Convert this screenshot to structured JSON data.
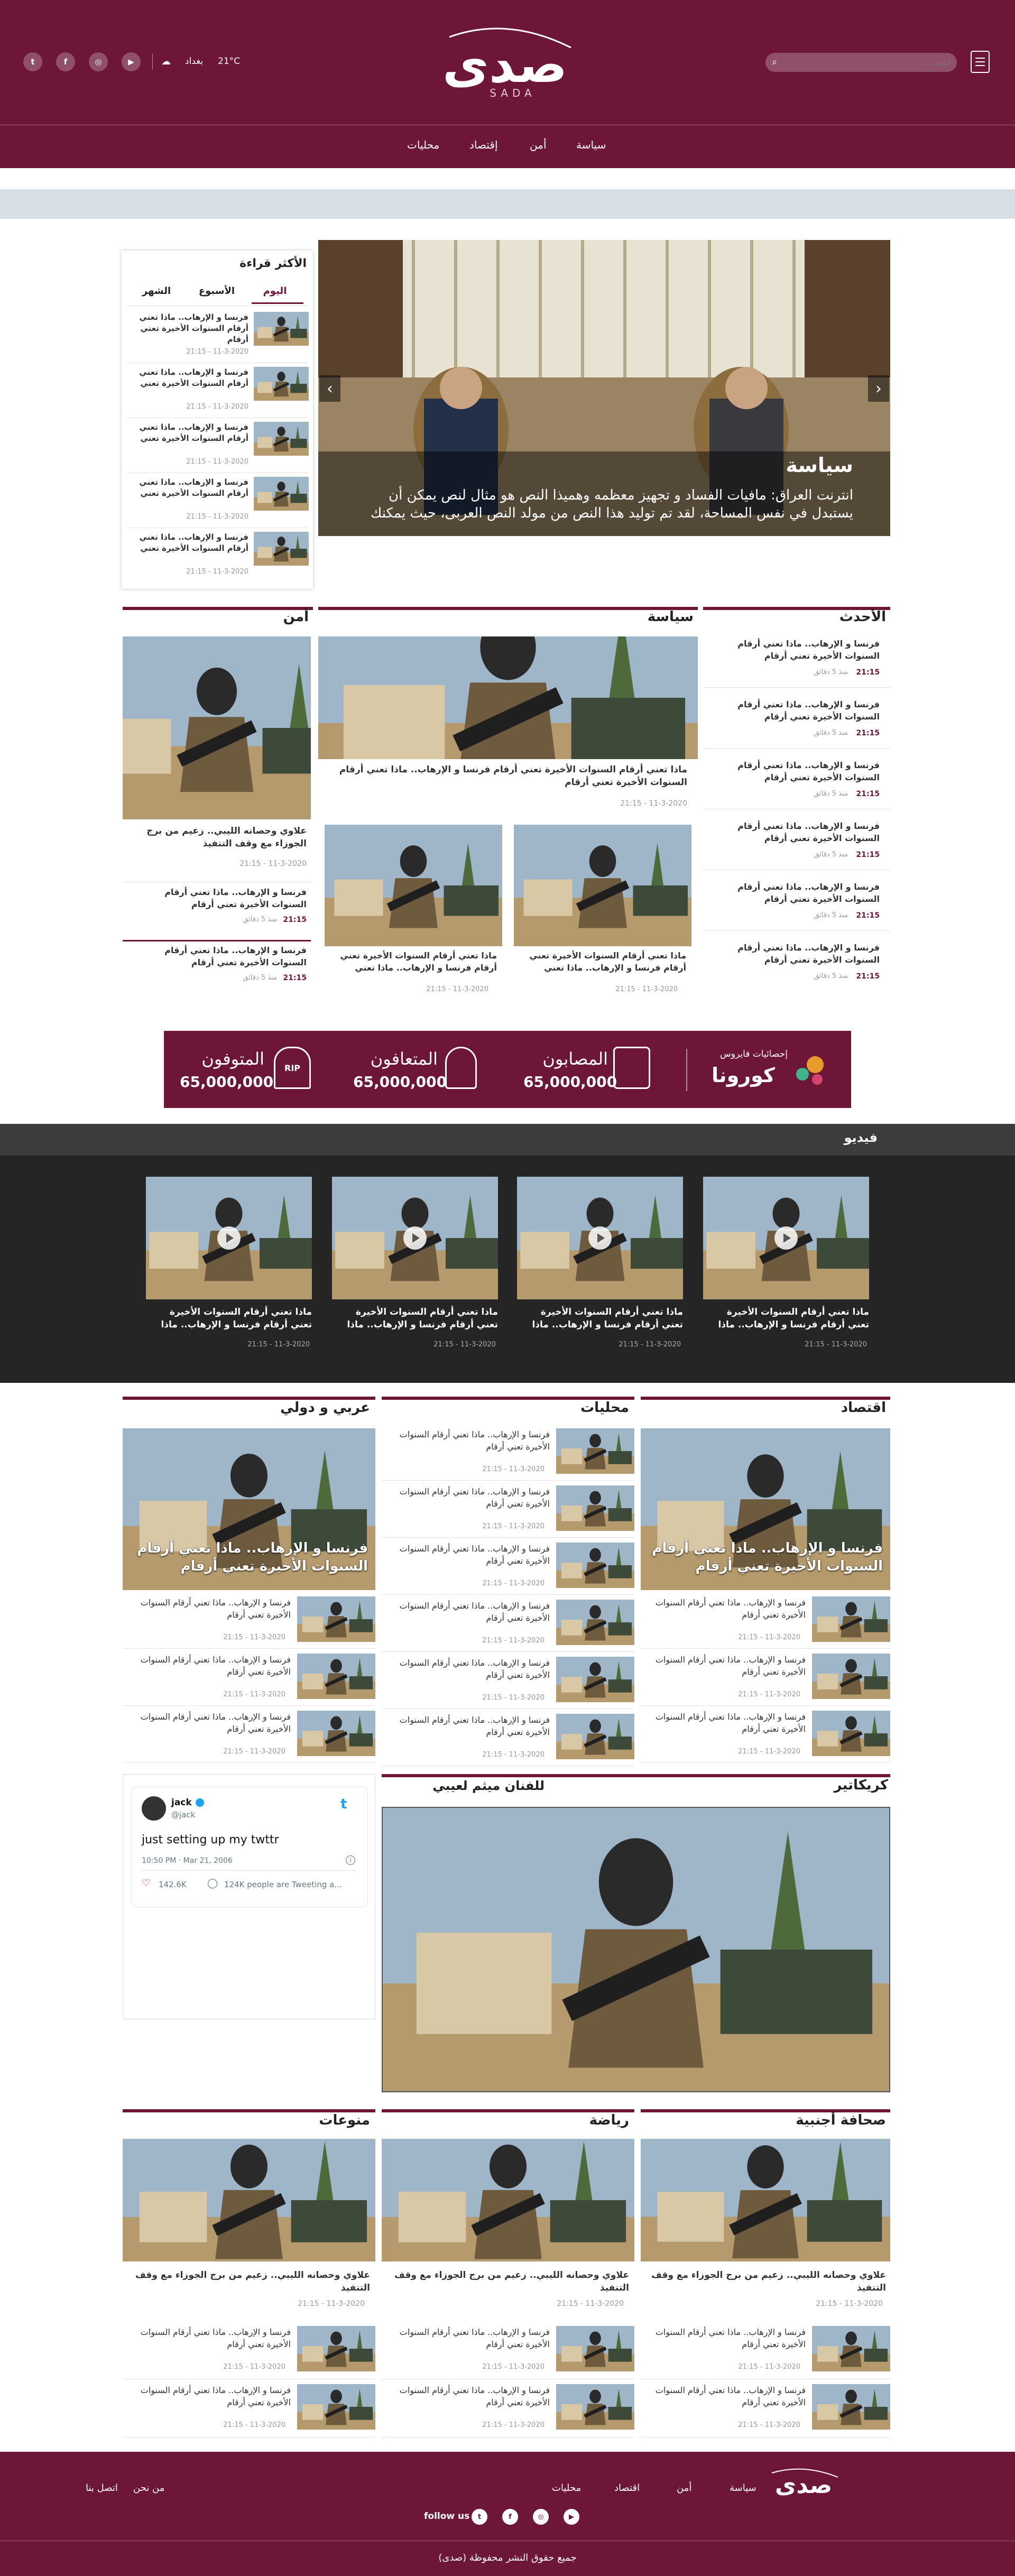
{
  "header": {
    "logo_text": "صدى",
    "logo_sub": "SADA",
    "search_placeholder": "ابحث ...",
    "weather_city": "بغداد",
    "weather_temp": "21°C",
    "nav": [
      "سياسة",
      "أمن",
      "إقتصاد",
      "محليات"
    ]
  },
  "slider": {
    "category": "سياسة",
    "headline": "انترنت العراق: مافيات الفساد و تجهيز معظمه وهميذا النص هو مثال لنص يمكن أن يستبدل في نفس المساحة، لقد تم توليد هذا النص من مولد النص العربى، حيث يمكنك"
  },
  "most_read": {
    "title": "الأكثر قراءة",
    "tabs": [
      "اليوم",
      "الأسبوع",
      "الشهر"
    ],
    "items": [
      {
        "text": "فرنسا و الإرهاب.. ماذا تعني أرقام السنوات الأخيرة تعني أرقام",
        "date": "11-3-2020 - 21:15"
      },
      {
        "text": "فرنسا و الإرهاب.. ماذا تعني أرقام السنوات الأخيرة تعني",
        "date": "11-3-2020 - 21:15"
      },
      {
        "text": "فرنسا و الإرهاب.. ماذا تعني أرقام السنوات الأخيرة تعني",
        "date": "11-3-2020 - 21:15"
      },
      {
        "text": "فرنسا و الإرهاب.. ماذا تعني أرقام السنوات الأخيرة تعني",
        "date": "11-3-2020 - 21:15"
      },
      {
        "text": "فرنسا و الإرهاب.. ماذا تعني أرقام السنوات الأخيرة تعني",
        "date": "11-3-2020 - 21:15"
      }
    ]
  },
  "latest": {
    "title": "الأحدث",
    "items": [
      {
        "text": "فرنسا و الإرهاب.. ماذا تعني أرقام السنوات الأخيرة تعني أرقام",
        "time": "21:15",
        "ago": "منذ 5 دقائق"
      },
      {
        "text": "فرنسا و الإرهاب.. ماذا تعني أرقام السنوات الأخيرة تعني أرقام",
        "time": "21:15",
        "ago": "منذ 5 دقائق"
      },
      {
        "text": "فرنسا و الإرهاب.. ماذا تعني أرقام السنوات الأخيرة تعني أرقام",
        "time": "21:15",
        "ago": "منذ 5 دقائق"
      },
      {
        "text": "فرنسا و الإرهاب.. ماذا تعني أرقام السنوات الأخيرة تعني أرقام",
        "time": "21:15",
        "ago": "منذ 5 دقائق"
      },
      {
        "text": "فرنسا و الإرهاب.. ماذا تعني أرقام السنوات الأخيرة تعني أرقام",
        "time": "21:15",
        "ago": "منذ 5 دقائق"
      },
      {
        "text": "فرنسا و الإرهاب.. ماذا تعني أرقام السنوات الأخيرة تعني أرقام",
        "time": "21:15",
        "ago": "منذ 5 دقائق"
      }
    ]
  },
  "politics": {
    "title": "سياسة",
    "main_text": "ماذا تعني أرقام السنوات الأخيرة تعني أرقام فرنسا و الإرهاب.. ماذا تعني أرقام السنوات الأخيرة تعني أرقام",
    "main_date": "11-3-2020 - 21:15",
    "sub": [
      {
        "text": "ماذا تعني أرقام السنوات الأخيرة تعني أرقام فرنسا و الإرهاب.. ماذا تعني",
        "date": "11-3-2020 - 21:15"
      },
      {
        "text": "ماذا تعني أرقام السنوات الأخيرة تعني أرقام فرنسا و الإرهاب.. ماذا تعني",
        "date": "11-3-2020 - 21:15"
      }
    ]
  },
  "security": {
    "title": "أمن",
    "main_text": "علاوي وحصانه الليبي.. زعيم من برج الجوزاء مع وقف التنفيذ",
    "main_date": "11-3-2020 - 21:15",
    "items": [
      {
        "text": "فرنسا و الإرهاب.. ماذا تعني أرقام السنوات الأخيرة تعني أرقام",
        "time": "21:15",
        "ago": "منذ 5 دقائق"
      },
      {
        "text": "فرنسا و الإرهاب.. ماذا تعني أرقام السنوات الأخيرة تعني أرقام",
        "time": "21:15",
        "ago": "منذ 5 دقائق"
      }
    ]
  },
  "corona": {
    "label_small": "إحصائيات فايروس",
    "label_big": "كورونا",
    "stats": [
      {
        "label": "المصابون",
        "value": "65,000,000"
      },
      {
        "label": "المتعافون",
        "value": "65,000,000"
      },
      {
        "label": "المتوفون",
        "value": "65,000,000"
      }
    ]
  },
  "video": {
    "title": "فيديو",
    "items": [
      {
        "text": "ماذا تعني أرقام السنوات الأخيرة تعني أرقام فرنسا و الإرهاب.. ماذا",
        "date": "11-3-2020 - 21:15"
      },
      {
        "text": "ماذا تعني أرقام السنوات الأخيرة تعني أرقام فرنسا و الإرهاب.. ماذا",
        "date": "11-3-2020 - 21:15"
      },
      {
        "text": "ماذا تعني أرقام السنوات الأخيرة تعني أرقام فرنسا و الإرهاب.. ماذا",
        "date": "11-3-2020 - 21:15"
      },
      {
        "text": "ماذا تعني أرقام السنوات الأخيرة تعني أرقام فرنسا و الإرهاب.. ماذا",
        "date": "11-3-2020 - 21:15"
      }
    ]
  },
  "economy": {
    "title": "اقتصاد",
    "overlay": "فرنسا و الإرهاب.. ماذا تعني أرقام السنوات الأخيرة تعني أرقام",
    "items": [
      {
        "text": "فرنسا و الإرهاب.. ماذا تعني أرقام السنوات الأخيرة تعني أرقام",
        "date": "11-3-2020 - 21:15"
      },
      {
        "text": "فرنسا و الإرهاب.. ماذا تعني أرقام السنوات الأخيرة تعني أرقام",
        "date": "11-3-2020 - 21:15"
      },
      {
        "text": "فرنسا و الإرهاب.. ماذا تعني أرقام السنوات الأخيرة تعني أرقام",
        "date": "11-3-2020 - 21:15"
      }
    ]
  },
  "local": {
    "title": "محليات",
    "items": [
      {
        "text": "فرنسا و الإرهاب.. ماذا تعني أرقام السنوات الأخيرة تعني أرقام",
        "date": "11-3-2020 - 21:15"
      },
      {
        "text": "فرنسا و الإرهاب.. ماذا تعني أرقام السنوات الأخيرة تعني أرقام",
        "date": "11-3-2020 - 21:15"
      },
      {
        "text": "فرنسا و الإرهاب.. ماذا تعني أرقام السنوات الأخيرة تعني أرقام",
        "date": "11-3-2020 - 21:15"
      },
      {
        "text": "فرنسا و الإرهاب.. ماذا تعني أرقام السنوات الأخيرة تعني أرقام",
        "date": "11-3-2020 - 21:15"
      },
      {
        "text": "فرنسا و الإرهاب.. ماذا تعني أرقام السنوات الأخيرة تعني أرقام",
        "date": "11-3-2020 - 21:15"
      },
      {
        "text": "فرنسا و الإرهاب.. ماذا تعني أرقام السنوات الأخيرة تعني أرقام",
        "date": "11-3-2020 - 21:15"
      }
    ]
  },
  "arab": {
    "title": "عربي و دولي",
    "overlay": "فرنسا و الإرهاب.. ماذا تعني أرقام السنوات الأخيرة تعني أرقام",
    "items": [
      {
        "text": "فرنسا و الإرهاب.. ماذا تعني أرقام السنوات الأخيرة تعني أرقام",
        "date": "11-3-2020 - 21:15"
      },
      {
        "text": "فرنسا و الإرهاب.. ماذا تعني أرقام السنوات الأخيرة تعني أرقام",
        "date": "11-3-2020 - 21:15"
      },
      {
        "text": "فرنسا و الإرهاب.. ماذا تعني أرقام السنوات الأخيرة تعني أرقام",
        "date": "11-3-2020 - 21:15"
      }
    ]
  },
  "caricature": {
    "title": "كريكاتير",
    "credit": "للفنان ميثم لعيبي"
  },
  "tweet": {
    "name": "jack",
    "handle": "@jack",
    "text": "just setting up my twttr",
    "time": "10:50 PM · Mar 21, 2006",
    "likes": "142.6K",
    "replies": "124K people are Tweeting a..."
  },
  "foreign": {
    "title": "صحافة أجنبية",
    "main_text": "علاوي وحصانه الليبي.. زعيم من برج الجوزاء مع وقف التنفيذ",
    "main_date": "11-3-2020 - 21:15",
    "items": [
      {
        "text": "فرنسا و الإرهاب.. ماذا تعني أرقام السنوات الأخيرة تعني أرقام",
        "date": "11-3-2020 - 21:15"
      },
      {
        "text": "فرنسا و الإرهاب.. ماذا تعني أرقام السنوات الأخيرة تعني أرقام",
        "date": "11-3-2020 - 21:15"
      }
    ]
  },
  "sports": {
    "title": "رياضة",
    "main_text": "علاوي وحصانه الليبي.. زعيم من برج الجوزاء مع وقف التنفيذ",
    "main_date": "11-3-2020 - 21:15",
    "items": [
      {
        "text": "فرنسا و الإرهاب.. ماذا تعني أرقام السنوات الأخيرة تعني أرقام",
        "date": "11-3-2020 - 21:15"
      },
      {
        "text": "فرنسا و الإرهاب.. ماذا تعني أرقام السنوات الأخيرة تعني أرقام",
        "date": "11-3-2020 - 21:15"
      }
    ]
  },
  "misc": {
    "title": "منوعات",
    "main_text": "علاوي وحصانه الليبي.. زعيم من برج الجوزاء مع وقف التنفيذ",
    "main_date": "11-3-2020 - 21:15",
    "items": [
      {
        "text": "فرنسا و الإرهاب.. ماذا تعني أرقام السنوات الأخيرة تعني أرقام",
        "date": "11-3-2020 - 21:15"
      },
      {
        "text": "فرنسا و الإرهاب.. ماذا تعني أرقام السنوات الأخيرة تعني أرقام",
        "date": "11-3-2020 - 21:15"
      }
    ]
  },
  "footer": {
    "links": [
      "سياسة",
      "أمن",
      "اقتصاد",
      "محليات",
      "من نحن",
      "اتصل بنا"
    ],
    "follow": "follow us",
    "copyright": "جميع حقوق النشر محفوظة (صدى)"
  },
  "colors": {
    "brand": "#6d1638",
    "dark": "#252525"
  }
}
